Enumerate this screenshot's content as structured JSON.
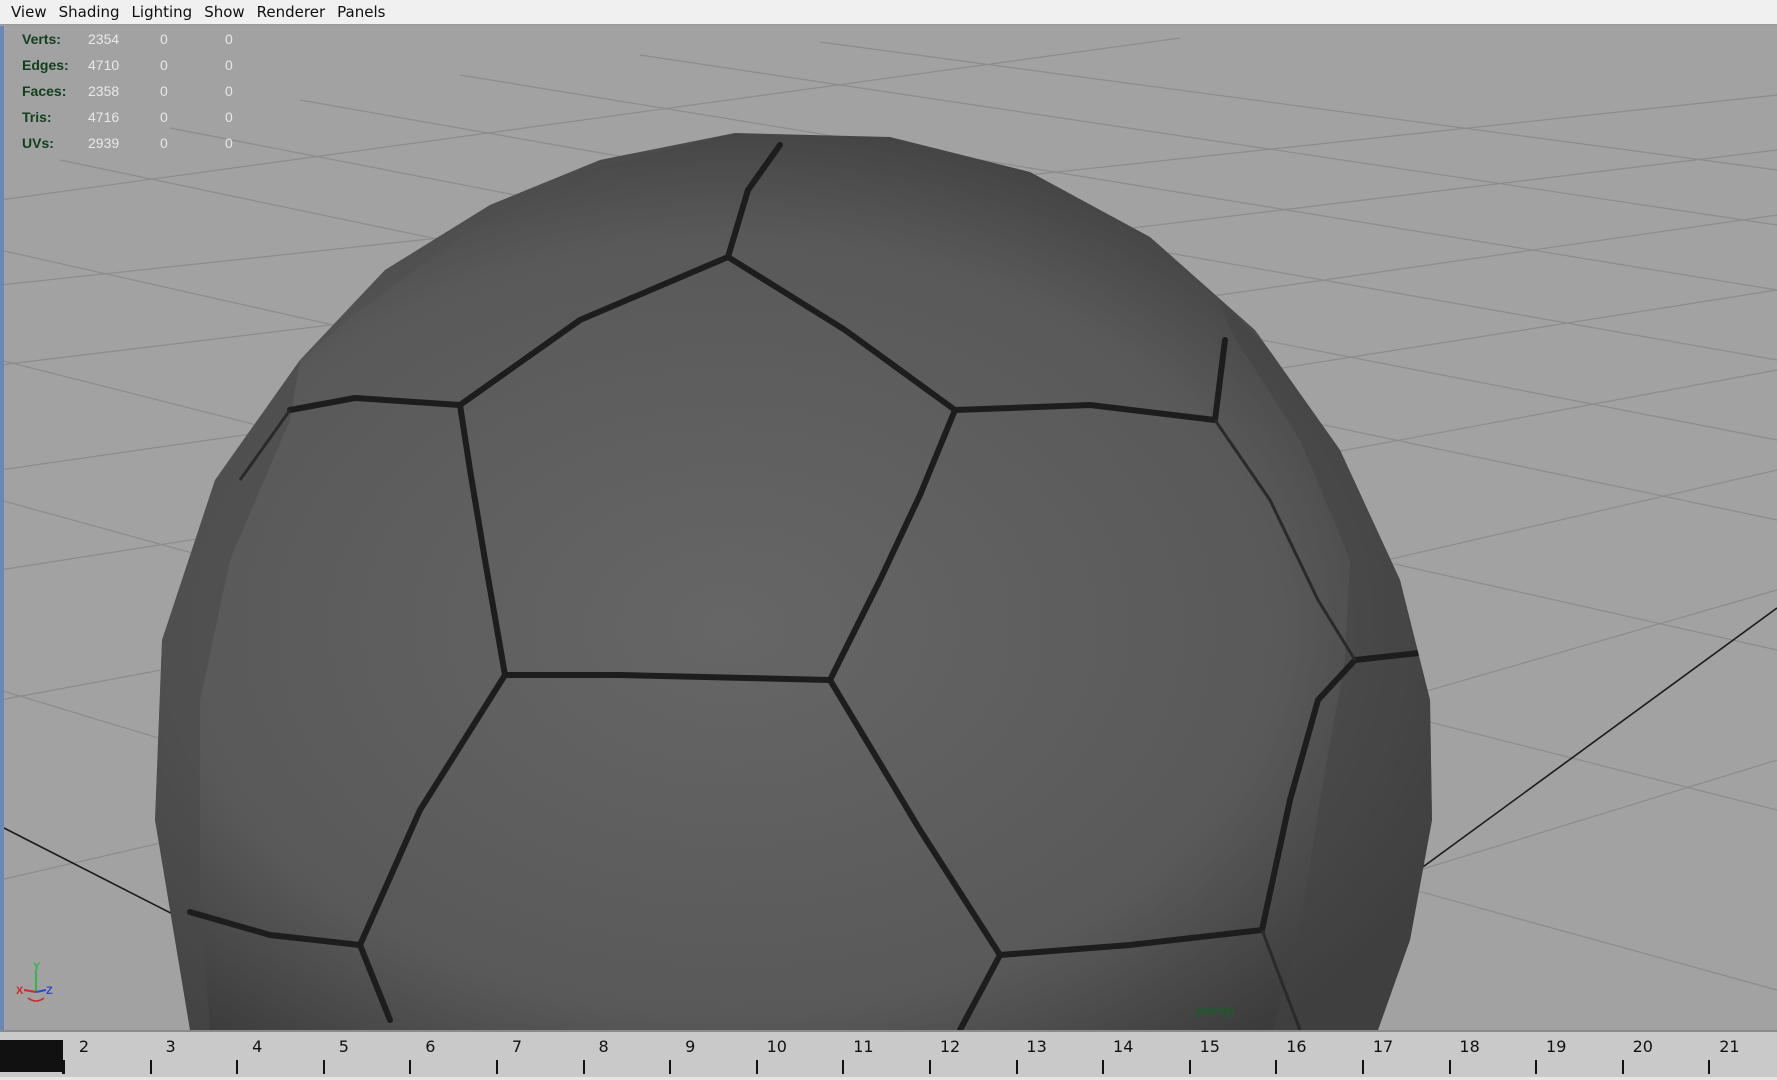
{
  "menu": [
    "View",
    "Shading",
    "Lighting",
    "Show",
    "Renderer",
    "Panels"
  ],
  "hud": {
    "rows": [
      {
        "label": "Verts:",
        "values": [
          "2354",
          "0",
          "0"
        ]
      },
      {
        "label": "Edges:",
        "values": [
          "4710",
          "0",
          "0"
        ]
      },
      {
        "label": "Faces:",
        "values": [
          "2358",
          "0",
          "0"
        ]
      },
      {
        "label": "Tris:",
        "values": [
          "4716",
          "0",
          "0"
        ]
      },
      {
        "label": "UVs:",
        "values": [
          "2939",
          "0",
          "0"
        ]
      }
    ]
  },
  "viewport": {
    "camera_label": "persp",
    "axis_labels": {
      "x": "X",
      "y": "Y",
      "z": "Z"
    }
  },
  "timeline": {
    "current_frame": 1,
    "ticks": [
      "2",
      "3",
      "4",
      "5",
      "6",
      "7",
      "8",
      "9",
      "10",
      "11",
      "12",
      "13",
      "14",
      "15",
      "16",
      "17",
      "18",
      "19",
      "20",
      "21"
    ]
  },
  "colors": {
    "viewport_bg": "#a2a2a2",
    "grid": "#8f8f8f",
    "mesh": "#5f5f5f",
    "seam": "#1a1a1a",
    "hud_label": "#12401f",
    "camera_label": "#1f5a2a"
  }
}
